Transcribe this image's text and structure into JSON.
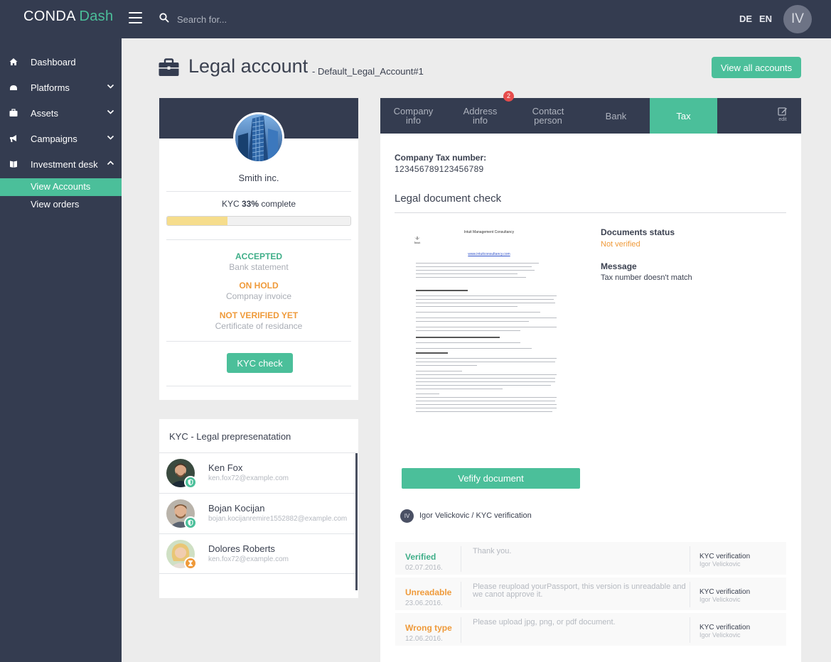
{
  "app": {
    "brand_main": "CONDA",
    "brand_accent": "Dash"
  },
  "search": {
    "placeholder": "Search for..."
  },
  "languages": [
    "DE",
    "EN"
  ],
  "user": {
    "initials": "IV"
  },
  "sidebar": {
    "items": [
      {
        "label": "Dashboard",
        "icon": "home-icon"
      },
      {
        "label": "Platforms",
        "icon": "platform-icon"
      },
      {
        "label": "Assets",
        "icon": "briefcase-icon"
      },
      {
        "label": "Campaigns",
        "icon": "megaphone-icon"
      },
      {
        "label": "Investment desk",
        "icon": "book-icon"
      }
    ],
    "subitems": [
      {
        "label": "View Accounts",
        "active": true
      },
      {
        "label": "View orders",
        "active": false
      }
    ]
  },
  "header": {
    "title": "Legal account",
    "subtitle": "- Default_Legal_Account#1",
    "view_all_label": "View all accounts"
  },
  "profile": {
    "name": "Smith inc.",
    "kyc_prefix": "KYC ",
    "kyc_percent": "33%",
    "kyc_suffix": " complete",
    "kyc_progress": 0.33,
    "documents": [
      {
        "status": "ACCEPTED",
        "name": "Bank statement",
        "color": "#3fae88"
      },
      {
        "status": "ON HOLD",
        "name": "Compnay invoice",
        "color": "#ef9a3a"
      },
      {
        "status": "NOT VERIFIED YET",
        "name": "Certificate of residance",
        "color": "#ef9a3a"
      }
    ],
    "kyc_button": "KYC check"
  },
  "representation": {
    "title": "KYC - Legal prepresenatation",
    "people": [
      {
        "name": "Ken Fox",
        "email": "ken.fox72@example.com",
        "badge": "shield-icon"
      },
      {
        "name": "Bojan Kocijan",
        "email": "bojan.kocijanremire1552882@example.com",
        "badge": "shield-icon"
      },
      {
        "name": "Dolores Roberts",
        "email": "ken.fox72@example.com",
        "badge": "hourglass-icon"
      }
    ]
  },
  "tabs": {
    "company_info": [
      "Company",
      "info"
    ],
    "address_info": [
      "Address",
      "info"
    ],
    "contact_person": [
      "Contact",
      "person"
    ],
    "bank": "Bank",
    "tax": "Tax",
    "badge_count": "2",
    "edit_label": "edit"
  },
  "tax": {
    "number_label": "Company Tax number:",
    "number_value": "123456789123456789",
    "section_title": "Legal document check",
    "doc_status_label": "Documents status",
    "doc_status_value": "Not verified",
    "message_label": "Message",
    "message_value": "Tax number doesn't match",
    "verify_button": "Vefify document",
    "verifier_initials": "IV",
    "verifier_text": "Igor Velickovic / KYC verification"
  },
  "document_preview": {
    "company": "Intuit Management Consultancy",
    "logo_text": "Intuit",
    "link": "www.intuitconsultancy.com"
  },
  "history": [
    {
      "status": "Verified",
      "date": "02.07.2016.",
      "message": "Thank you.",
      "type": "KYC verification",
      "by": "Igor Velickovic",
      "color": "#3fae88"
    },
    {
      "status": "Unreadable",
      "date": "23.06.2016.",
      "message": "Please reupload yourPassport, this version is unreadable and we canot approve it.",
      "type": "KYC verification",
      "by": "Igor Velickovic",
      "color": "#ef9a3a"
    },
    {
      "status": "Wrong type",
      "date": "12.06.2016.",
      "message": "Please upload jpg, png, or pdf document.",
      "type": "KYC verification",
      "by": "Igor Velickovic",
      "color": "#ef9a3a"
    }
  ],
  "colors": {
    "accent": "#4bbf9a",
    "navy": "#343c50",
    "warning": "#ef9a3a",
    "badge": "#e64c4c"
  }
}
